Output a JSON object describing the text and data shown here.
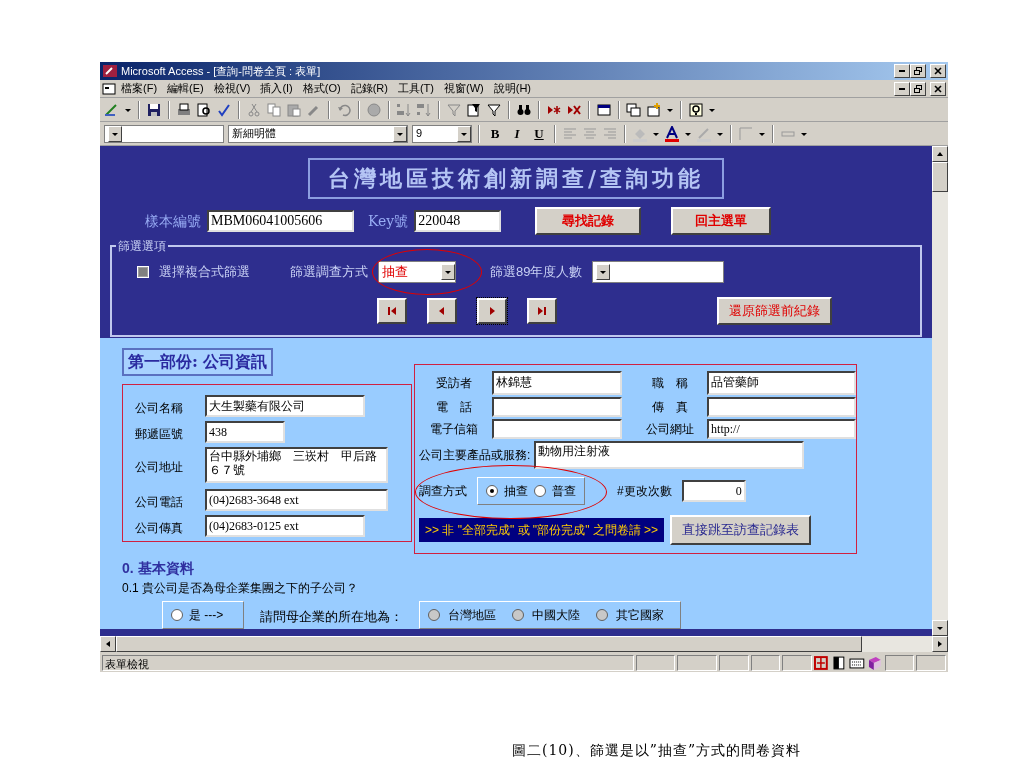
{
  "window": {
    "title": "Microsoft Access - [查詢-問卷全頁 : 表單]"
  },
  "menu": [
    "檔案(F)",
    "編輯(E)",
    "檢視(V)",
    "插入(I)",
    "格式(O)",
    "記錄(R)",
    "工具(T)",
    "視窗(W)",
    "說明(H)"
  ],
  "format_bar": {
    "font": "新細明體",
    "size": "9",
    "bold": "B",
    "italic": "I",
    "underline": "U"
  },
  "form": {
    "title": "台灣地區技術創新調查/查詢功能",
    "sample_label": "樣本編號",
    "sample_value": "MBM06041005606",
    "key_label": "Key號",
    "key_value": "220048",
    "buttons": [
      "尋找記錄",
      "回主選單"
    ],
    "filter": {
      "legend": "篩選選項",
      "checkbox_indeterminate": true,
      "checkbox_label": "選擇複合式篩選",
      "method_label": "篩選調查方式",
      "method_value": "抽查",
      "headcount_label": "篩選89年度人數",
      "restore_button": "還原篩選前紀錄"
    }
  },
  "section": {
    "title": "第一部份: 公司資訊",
    "company_fields": [
      {
        "label": "公司名稱",
        "value": "大生製藥有限公司"
      },
      {
        "label": "郵遞區號",
        "value": "438"
      },
      {
        "label": "公司地址",
        "value": "台中縣外埔鄉　三崁村　甲后路６７號"
      },
      {
        "label": "公司電話",
        "value": "(04)2683-3648 ext"
      },
      {
        "label": "公司傳真",
        "value": "(04)2683-0125 ext"
      }
    ],
    "contact_rows": [
      [
        {
          "label": "受訪者",
          "value": "林錦慧"
        },
        {
          "label": "職　稱",
          "value": "品管藥師"
        }
      ],
      [
        {
          "label": "電　話"
        },
        {
          "label": "傳　真"
        }
      ],
      [
        {
          "label": "電子信箱"
        },
        {
          "label": "公司網址",
          "value": "http://"
        }
      ]
    ],
    "product_label": "公司主要產品或服務:",
    "product_value": "動物用注射液",
    "method_label": "調查方式",
    "method_options": [
      {
        "label": "抽查",
        "selected": true
      },
      {
        "label": "普查",
        "selected": false
      }
    ],
    "changes_label": "#更改次數",
    "changes_value": "0",
    "banner": ">> 非 \"全部完成\" 或 \"部份完成\" 之問卷請 >>",
    "jump_button": "直接跳至訪查記錄表"
  },
  "basic": {
    "heading": "0. 基本資料",
    "question": "0.1  貴公司是否為母企業集團之下的子公司？",
    "yes_option": {
      "label": "是 --->",
      "selected": false
    },
    "prompt": "請問母企業的所在地為：",
    "locations": [
      {
        "label": "台灣地區",
        "disabled": true
      },
      {
        "label": "中國大陸",
        "disabled": true
      },
      {
        "label": "其它國家",
        "disabled": true
      }
    ]
  },
  "status_bar": {
    "text": "表單檢視"
  },
  "caption": "圖二(10)、篩選是以”抽查”方式的問卷資料"
}
